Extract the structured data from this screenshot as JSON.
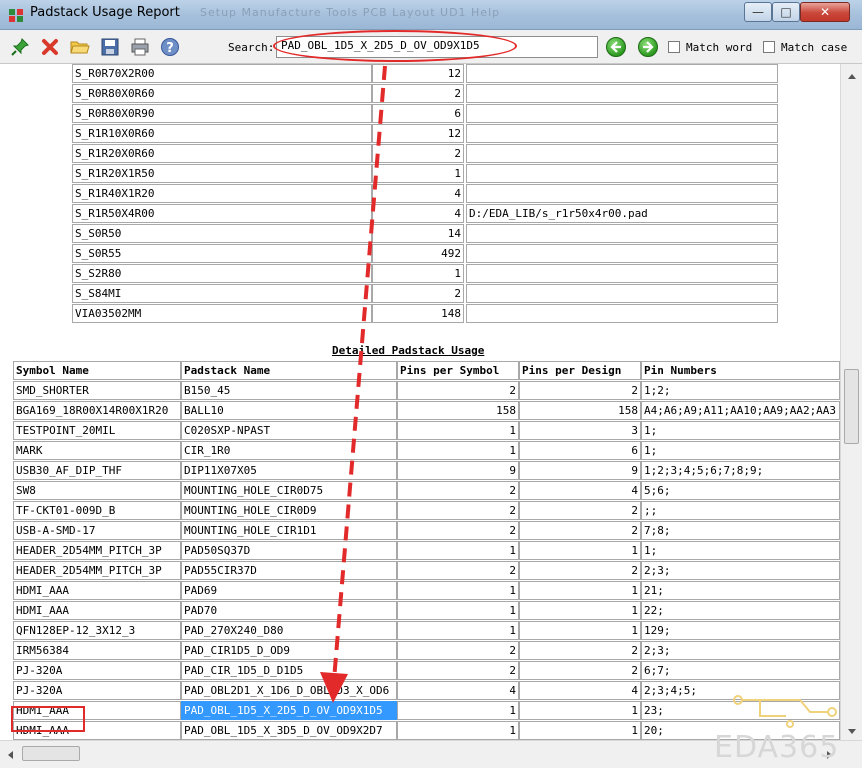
{
  "window": {
    "title": "Padstack Usage Report",
    "ghost_menu": "Setup   Manufacture   Tools   PCB Layout UD1   Help"
  },
  "toolbar": {
    "search_label": "Search:",
    "search_value": "PAD_OBL_1D5_X_2D5_D_OV_OD9X1D5",
    "match_word": "Match word",
    "match_case": "Match case"
  },
  "summary_rows": [
    [
      "S_R0R70X2R00",
      "12",
      ""
    ],
    [
      "S_R0R80X0R60",
      "2",
      ""
    ],
    [
      "S_R0R80X0R90",
      "6",
      ""
    ],
    [
      "S_R1R10X0R60",
      "12",
      ""
    ],
    [
      "S_R1R20X0R60",
      "2",
      ""
    ],
    [
      "S_R1R20X1R50",
      "1",
      ""
    ],
    [
      "S_R1R40X1R20",
      "4",
      ""
    ],
    [
      "S_R1R50X4R00",
      "4",
      "D:/EDA_LIB/s_r1r50x4r00.pad"
    ],
    [
      "S_S0R50",
      "14",
      ""
    ],
    [
      "S_S0R55",
      "492",
      ""
    ],
    [
      "S_S2R80",
      "1",
      ""
    ],
    [
      "S_S84MI",
      "2",
      ""
    ],
    [
      "VIA03502MM",
      "148",
      ""
    ]
  ],
  "detail": {
    "title": "Detailed Padstack Usage",
    "headers": [
      "Symbol Name",
      "Padstack Name",
      "Pins per Symbol",
      "Pins per Design",
      "Pin Numbers"
    ],
    "rows": [
      [
        "SMD_SHORTER",
        "B150_45",
        "2",
        "2",
        "1;2;"
      ],
      [
        "BGA169_18R00X14R00X1R20",
        "BALL10",
        "158",
        "158",
        "A4;A6;A9;A11;AA10;AA9;AA2;AA3"
      ],
      [
        "TESTPOINT_20MIL",
        "C020SXP-NPAST",
        "1",
        "3",
        "1;"
      ],
      [
        "MARK",
        "CIR_1R0",
        "1",
        "6",
        "1;"
      ],
      [
        "USB30_AF_DIP_THF",
        "DIP11X07X05",
        "9",
        "9",
        "1;2;3;4;5;6;7;8;9;"
      ],
      [
        "SW8",
        "MOUNTING_HOLE_CIR0D75",
        "2",
        "4",
        "5;6;"
      ],
      [
        "TF-CKT01-009D_B",
        "MOUNTING_HOLE_CIR0D9",
        "2",
        "2",
        ";;"
      ],
      [
        "USB-A-SMD-17",
        "MOUNTING_HOLE_CIR1D1",
        "2",
        "2",
        "7;8;"
      ],
      [
        "HEADER_2D54MM_PITCH_3P",
        "PAD50SQ37D",
        "1",
        "1",
        "1;"
      ],
      [
        "HEADER_2D54MM_PITCH_3P",
        "PAD55CIR37D",
        "2",
        "2",
        "2;3;"
      ],
      [
        "HDMI_AAA",
        "PAD69",
        "1",
        "1",
        "21;"
      ],
      [
        "HDMI_AAA",
        "PAD70",
        "1",
        "1",
        "22;"
      ],
      [
        "QFN128EP-12_3X12_3",
        "PAD_270X240_D80",
        "1",
        "1",
        "129;"
      ],
      [
        "IRM56384",
        "PAD_CIR1D5_D_OD9",
        "2",
        "2",
        "2;3;"
      ],
      [
        "PJ-320A",
        "PAD_CIR_1D5_D_D1D5",
        "2",
        "2",
        "6;7;"
      ],
      [
        "PJ-320A",
        "PAD_OBL2D1_X_1D6_D_OBL1D3_X_OD6",
        "4",
        "4",
        "2;3;4;5;"
      ],
      [
        "HDMI_AAA",
        "PAD_OBL_1D5_X_2D5_D_OV_OD9X1D5",
        "1",
        "1",
        "23;"
      ],
      [
        "HDMI_AAA",
        "PAD_OBL_1D5_X_3D5_D_OV_OD9X2D7",
        "1",
        "1",
        "20;"
      ]
    ]
  },
  "watermark": "EDA365",
  "colors": {
    "highlight": "#3399ff",
    "annotation": "#e32a2a"
  }
}
